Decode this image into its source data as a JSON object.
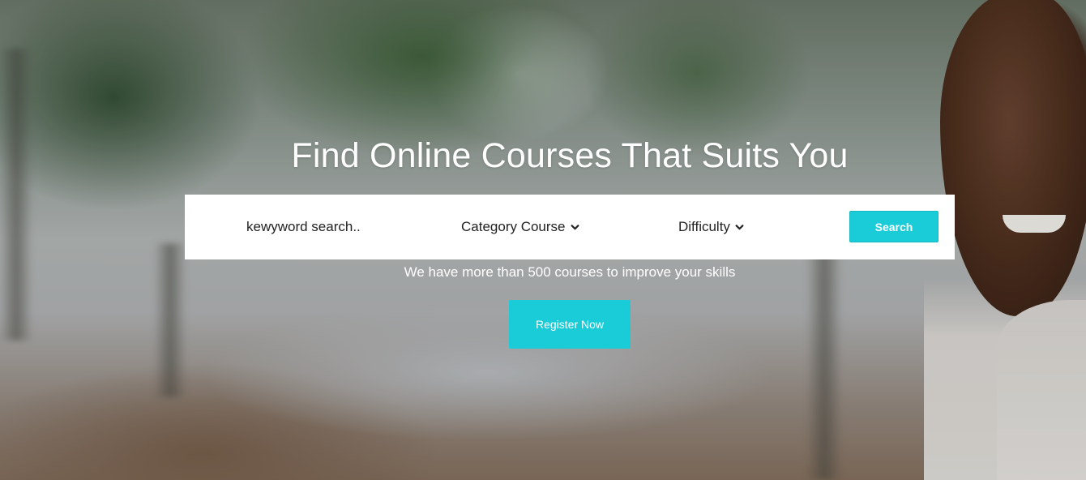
{
  "hero": {
    "title": "Find Online Courses That Suits You",
    "subtitle": "We have more than 500 courses to improve your skills",
    "register_label": "Register Now"
  },
  "search": {
    "keyword_placeholder": "kewyword search..",
    "category_label": "Category Course",
    "difficulty_label": "Difficulty",
    "button_label": "Search"
  },
  "icons": {
    "dropdown": "chevron-down-icon"
  },
  "colors": {
    "accent": "#19ccd8",
    "text": "#222222",
    "hero_text": "#ffffff"
  }
}
